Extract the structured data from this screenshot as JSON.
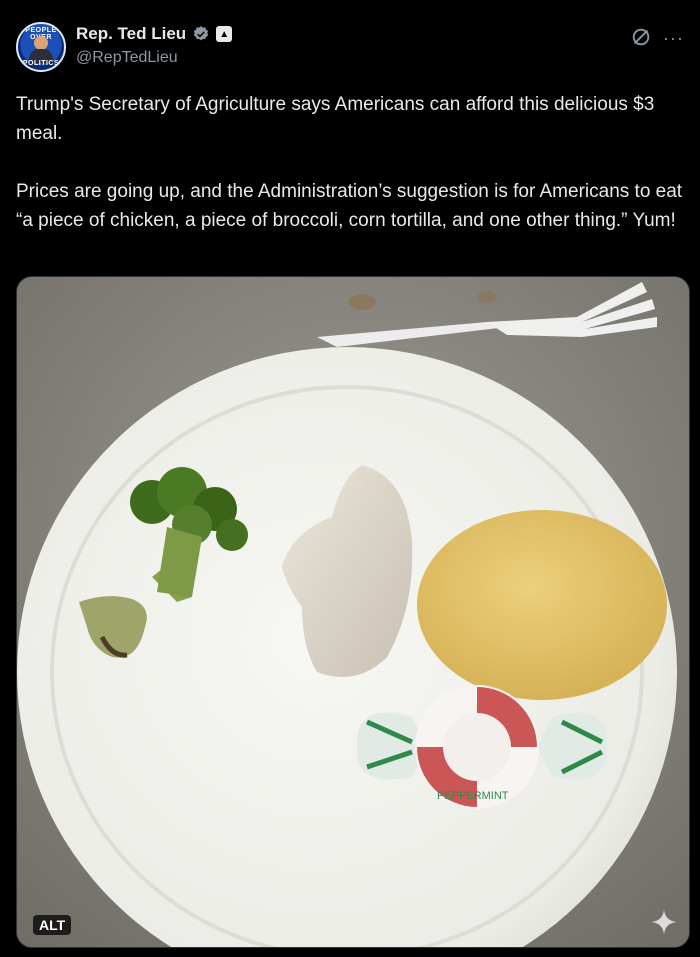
{
  "author": {
    "display_name": "Rep. Ted Lieu",
    "handle": "@RepTedLieu",
    "avatar_text_top": "PEOPLE OVER",
    "avatar_text_bottom": "POLITICS",
    "verified_icon": "verified-badge-icon",
    "affiliation_icon": "capitol-icon"
  },
  "actions": {
    "grok_icon": "grok-icon",
    "more_icon": "more-icon"
  },
  "tweet": {
    "text": "Trump's Secretary of Agriculture says Americans can afford this delicious $3 meal.\n\nPrices are going up, and the Administration’s suggestion is for Americans to eat “a piece of chicken, a piece of broccoli, corn tortilla, and one other thing.” Yum!"
  },
  "media": {
    "alt_label": "ALT",
    "candy_wrapper_text": "PEPPERMINT",
    "sparkle_icon": "sparkle-icon",
    "colors": {
      "table": "#8d8a83",
      "plate": "#efefeb",
      "broccoli": "#3f6b1f",
      "chicken": "#dcd6cb",
      "tortilla": "#e4c46e",
      "candy_stripe": "#c23a3a"
    }
  },
  "theme": {
    "background": "#000000",
    "text": "#e7e9ea",
    "muted": "#8b98a5",
    "verified_blue": "#1d9bf0"
  }
}
